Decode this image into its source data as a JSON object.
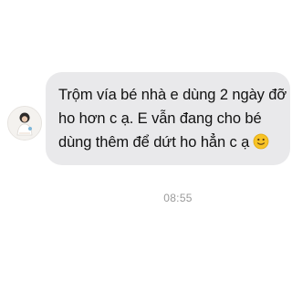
{
  "message": {
    "lines": [
      "Trộm vía bé nhà e dùng 2 ngày đỡ",
      "ho hơn c ạ. E vẫn đang cho bé",
      "dùng thêm để dứt ho hẳn c ạ"
    ],
    "emoji": "slightly-smiling-face-icon",
    "timestamp": "08:55"
  },
  "colors": {
    "bubble": "#e9e9eb",
    "text": "#111111",
    "timestamp": "#9a9a9a",
    "emoji": "#f7c325"
  }
}
